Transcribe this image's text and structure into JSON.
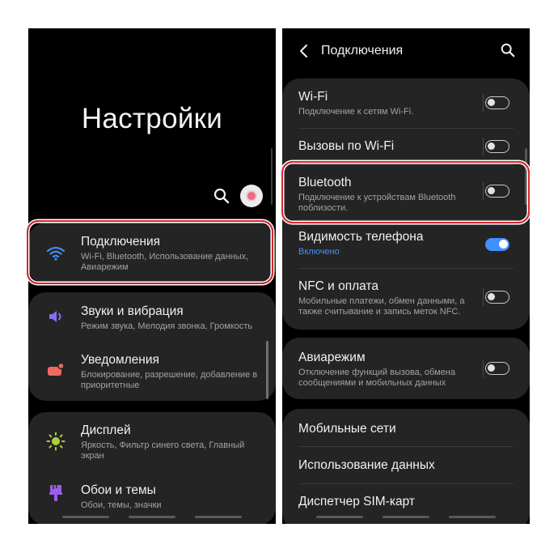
{
  "left_screen": {
    "title": "Настройки",
    "items": [
      {
        "label": "Подключения",
        "sub": "Wi-Fi, Bluetooth, Использование данных, Авиарежим",
        "icon": "wifi-icon"
      },
      {
        "label": "Звуки и вибрация",
        "sub": "Режим звука, Мелодия звонка, Громкость",
        "icon": "volume-icon"
      },
      {
        "label": "Уведомления",
        "sub": "Блокирование, разрешение, добавление в приоритетные",
        "icon": "notification-icon"
      },
      {
        "label": "Дисплей",
        "sub": "Яркость, Фильтр синего света, Главный экран",
        "icon": "brightness-icon"
      },
      {
        "label": "Обои и темы",
        "sub": "Обои, темы, значки",
        "icon": "palette-icon"
      }
    ]
  },
  "right_screen": {
    "title": "Подключения",
    "items": [
      {
        "label": "Wi-Fi",
        "sub": "Подключение к сетям Wi-Fi.",
        "toggle": "off"
      },
      {
        "label": "Вызовы по Wi-Fi",
        "sub": "",
        "toggle": "off"
      },
      {
        "label": "Bluetooth",
        "sub": "Подключение к устройствам Bluetooth поблизости.",
        "toggle": "off"
      },
      {
        "label": "Видимость телефона",
        "sub": "Включено",
        "toggle": "on"
      },
      {
        "label": "NFC и оплата",
        "sub": "Мобильные платежи, обмен данными, а также считывание и запись меток NFC.",
        "toggle": "off"
      },
      {
        "label": "Авиарежим",
        "sub": "Отключение функций вызова, обмена сообщениями и мобильных данных",
        "toggle": "off"
      },
      {
        "label": "Мобильные сети"
      },
      {
        "label": "Использование данных"
      },
      {
        "label": "Диспетчер SIM-карт"
      }
    ]
  },
  "colors": {
    "background": "#000000",
    "card": "#242424",
    "accent": "#3e91ff",
    "highlight": "#d8262c"
  }
}
